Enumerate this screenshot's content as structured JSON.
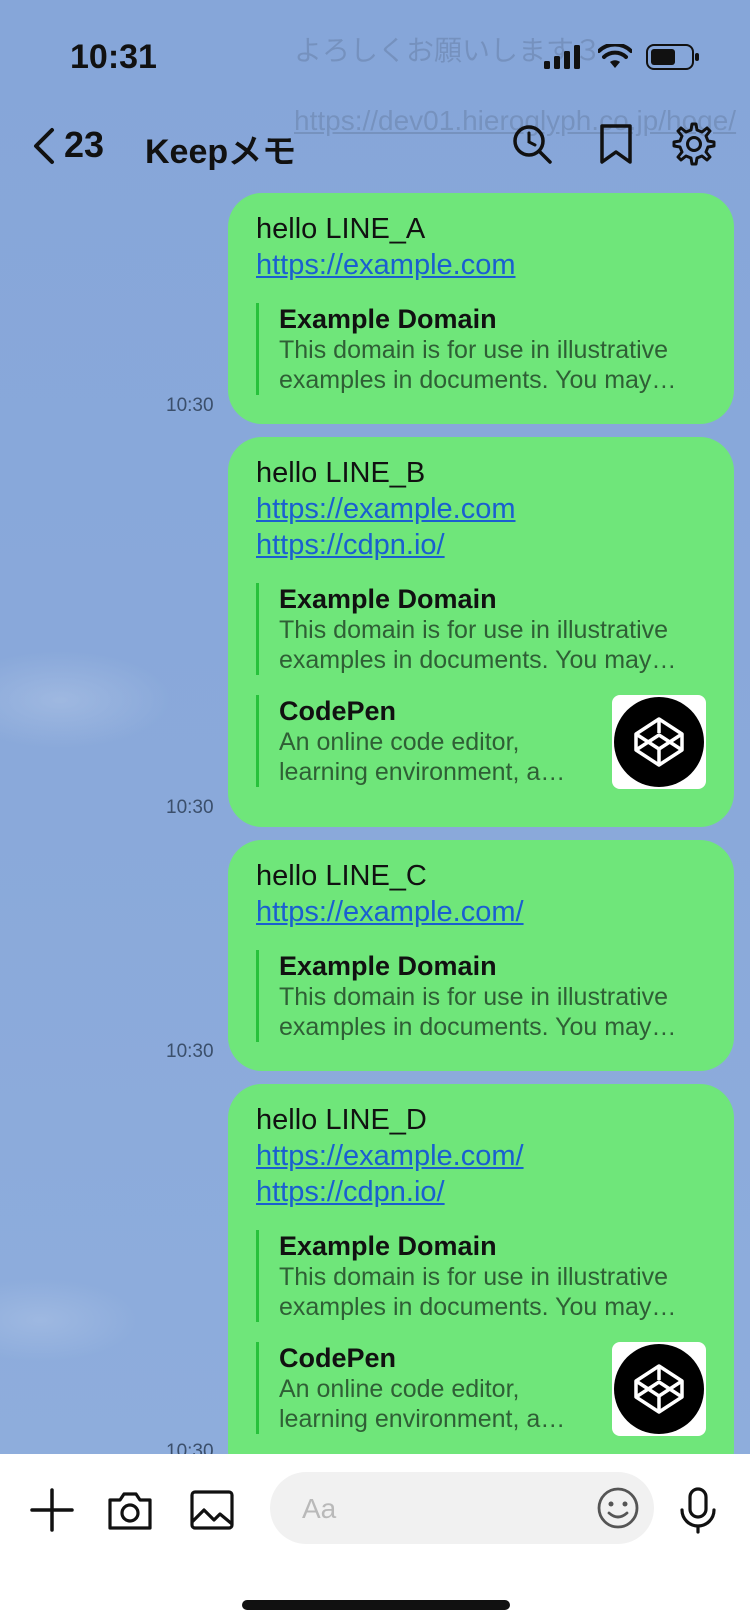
{
  "status": {
    "time": "10:31",
    "ghost_line1": "よろしくお願いします３",
    "ghost_line2": "https://dev01.hieroglyph.co.jp/hoge/"
  },
  "header": {
    "back_count": "23",
    "title": "Keepメモ",
    "icons": [
      "search-icon",
      "bookmark-icon",
      "gear-icon"
    ]
  },
  "messages": [
    {
      "label": "hello LINE_A",
      "links": [
        "https://example.com"
      ],
      "previews": [
        {
          "title": "Example Domain",
          "desc1": "This domain is for use in illustrative",
          "desc2": "examples in documents. You may…"
        }
      ],
      "time": "10:30"
    },
    {
      "label": "hello LINE_B",
      "links": [
        "https://example.com",
        "https://cdpn.io/"
      ],
      "previews": [
        {
          "title": "Example Domain",
          "desc1": "This domain is for use in illustrative",
          "desc2": "examples in documents. You may…"
        },
        {
          "title": "CodePen",
          "desc1": "An online code editor,",
          "desc2": "learning environment, a…",
          "thumb": "codepen-icon"
        }
      ],
      "time": "10:30"
    },
    {
      "label": "hello LINE_C",
      "links": [
        "https://example.com/"
      ],
      "previews": [
        {
          "title": "Example Domain",
          "desc1": "This domain is for use in illustrative",
          "desc2": "examples in documents. You may…"
        }
      ],
      "time": "10:30"
    },
    {
      "label": "hello LINE_D",
      "links": [
        "https://example.com/",
        "https://cdpn.io/"
      ],
      "previews": [
        {
          "title": "Example Domain",
          "desc1": "This domain is for use in illustrative",
          "desc2": "examples in documents. You may…"
        },
        {
          "title": "CodePen",
          "desc1": "An online code editor,",
          "desc2": "learning environment, a…",
          "thumb": "codepen-icon"
        }
      ],
      "time": "10:30"
    }
  ],
  "input": {
    "placeholder": "Aa",
    "icons": [
      "plus-icon",
      "camera-icon",
      "image-icon",
      "emoji-icon",
      "microphone-icon"
    ]
  },
  "colors": {
    "bubble": "#6fe67a",
    "link": "#1a5fd0",
    "background": "#8aa8d8"
  }
}
